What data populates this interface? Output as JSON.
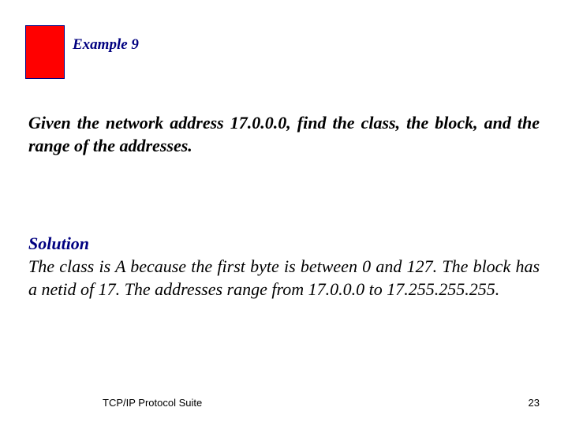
{
  "header": {
    "example_label": "Example 9"
  },
  "content": {
    "problem": "Given the network address 17.0.0.0, find the class, the block, and the range of the addresses.",
    "solution_heading": "Solution",
    "solution_body": "The class is A because the first byte is between 0 and 127. The block has a netid of 17. The addresses range from 17.0.0.0 to 17.255.255.255."
  },
  "footer": {
    "source": "TCP/IP Protocol Suite",
    "page_number": "23"
  }
}
